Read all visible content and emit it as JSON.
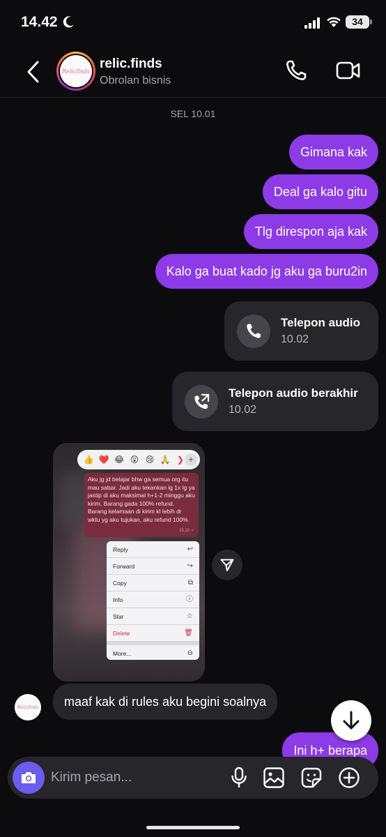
{
  "status_bar": {
    "time": "14.42",
    "battery": "34"
  },
  "header": {
    "name": "relic.finds",
    "subtitle": "Obrolan bisnis",
    "avatar_text": "Relicfinds"
  },
  "chat": {
    "date_separator": "SEL 10.01",
    "outgoing": [
      "Gimana kak",
      "Deal ga kalo gitu",
      "Tlg direspon aja kak",
      "Kalo ga buat kado jg aku ga buru2in"
    ],
    "calls": [
      {
        "title": "Telepon audio",
        "time": "10.02"
      },
      {
        "title": "Telepon audio berakhir",
        "time": "10.02"
      }
    ],
    "shared_screenshot": {
      "reactions": [
        "👍",
        "❤️",
        "😂",
        "😮",
        "😢",
        "🙏",
        "❯",
        "+"
      ],
      "message": "Aku jg jd belajar bhw ga semua org itu mau sabar. Jadi aku tekankan lg 1x lg ya jastip di aku maksimal h+1-2 minggu aku kirim. Barang gada 100% refund. Barang kelamaan di kirim kl lebih dr wktu yg aku tujukan, aku refund 100%",
      "message_time": "15.22 ✓",
      "menu": [
        {
          "label": "Reply",
          "icon": "↩"
        },
        {
          "label": "Forward",
          "icon": "↪"
        },
        {
          "label": "Copy",
          "icon": "⧉"
        },
        {
          "label": "Info",
          "icon": "ⓘ"
        },
        {
          "label": "Star",
          "icon": "☆"
        },
        {
          "label": "Delete",
          "icon": "🗑"
        },
        {
          "label": "More...",
          "icon": "⊖"
        }
      ]
    },
    "incoming": "maaf kak di rules aku begini soalnya",
    "last_outgoing": "Ini h+ berapa"
  },
  "composer": {
    "placeholder": "Kirim pesan..."
  },
  "colors": {
    "outgoing_bubble": "#8c3be6",
    "incoming_bubble": "#26262b",
    "background": "#0c0c0f",
    "camera_button": "#6d5cf0"
  }
}
